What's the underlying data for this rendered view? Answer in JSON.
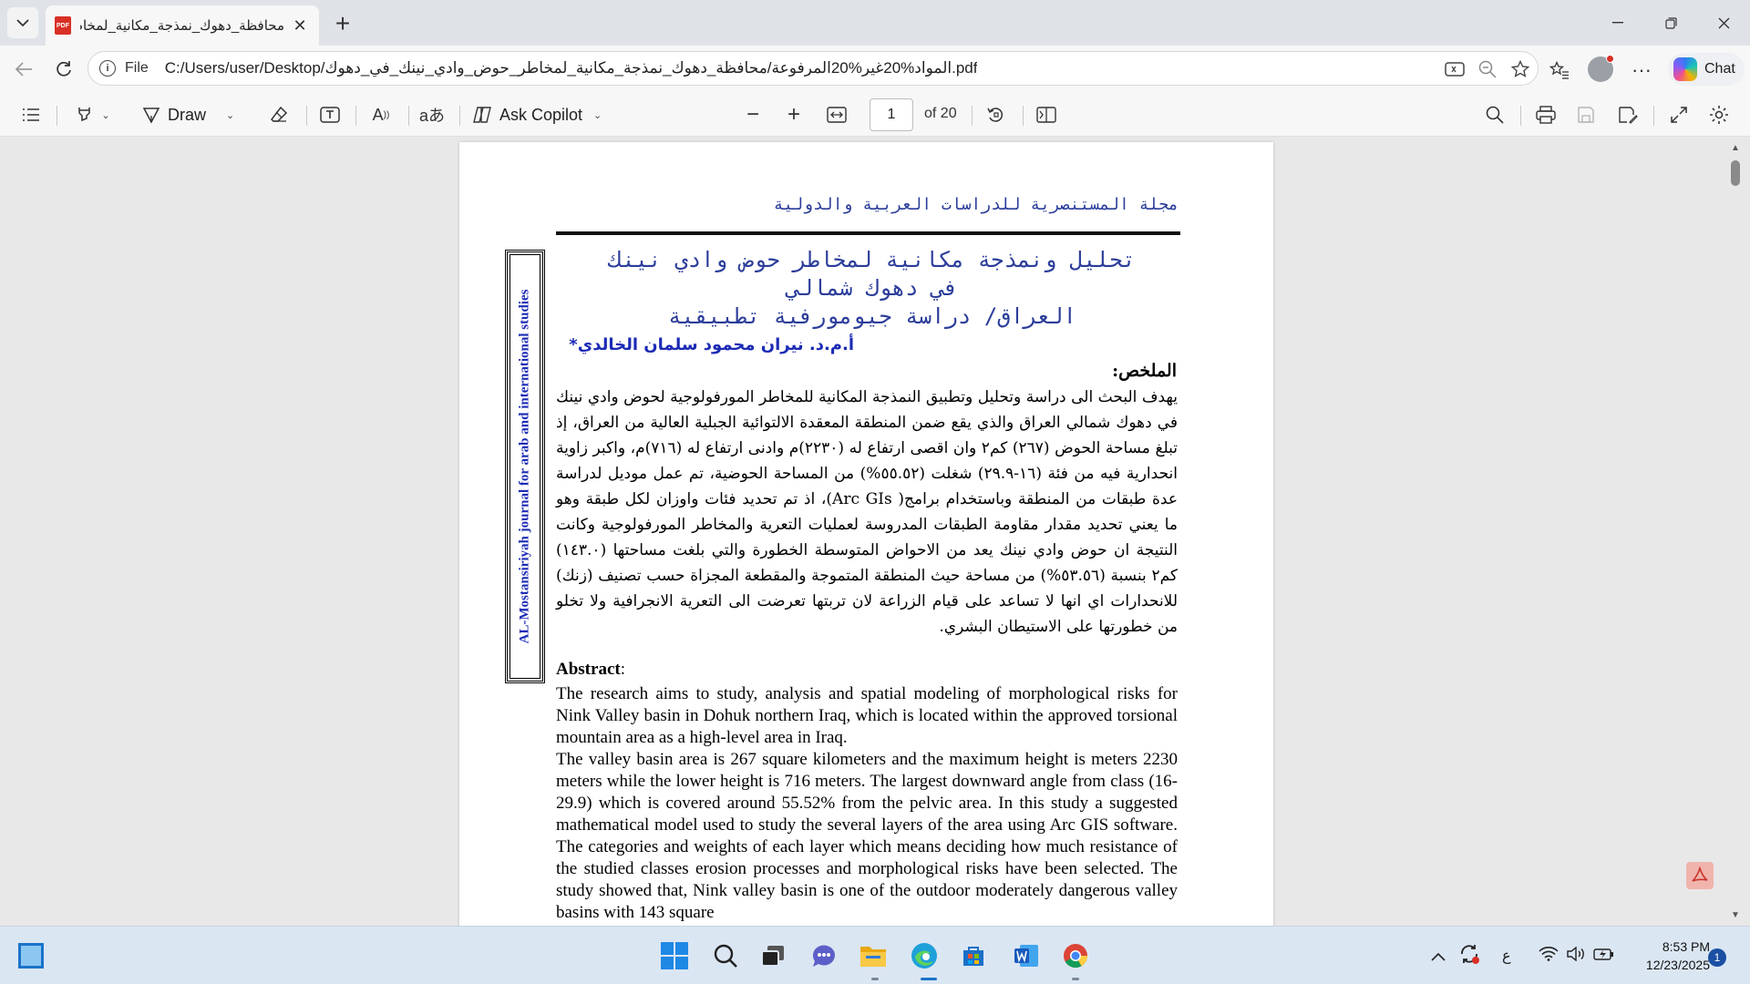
{
  "browser": {
    "tab_title": "محافظة_دهوك_نمذجة_مكانية_لمخاط...",
    "tab_icon": "pdf-icon",
    "address": {
      "scheme_label": "File",
      "url": "C:/Users/user/Desktop/المواد%20غير%20المرفوعة/محافظة_دهوك_نمذجة_مكانية_لمخاطر_حوض_وادي_نينك_في_دهوك.pdf"
    },
    "chat_label": "Chat"
  },
  "pdf_toolbar": {
    "draw_label": "Draw",
    "ask_copilot_label": "Ask Copilot",
    "page_current": "1",
    "page_total": "of 20"
  },
  "document": {
    "journal_header": "مجلة المستنصرية للدراسات العربية والدولية",
    "side_label": "AL-Mostansiriyah journal for arab and international studies",
    "title_lines": [
      "تحليل ونمذجة مكانية لمخاطر حوض وادي نينك",
      "في دهوك شمالي",
      "العراق/ دراسة جيومورفية تطبيقية"
    ],
    "author": "أ.م.د.  نيران محمود سلمان الخالدي*",
    "summary_heading": "الملخص:",
    "summary_text": "يهدف البحث الى دراسة وتحليل وتطبيق النمذجة المكانية للمخاطر المورفولوجية لحوض وادي نينك في دهوك شمالي العراق والذي يقع ضمن المنطقة المعقدة الالتوائية الجبلية العالية من العراق، إذ تبلغ مساحة الحوض (٢٦٧) كم٢ وان اقصى ارتفاع له (٢٢٣٠)م وادنى ارتفاع له (٧١٦)م، واكبر زاوية انحدارية فيه من فئة (١٦-٢٩.٩) شغلت (٥٥.٥٢%) من المساحة الحوضية، تم عمل موديل لدراسة عدة طبقات من المنطقة وباستخدام برامج( Arc GIs)، اذ تم تحديد فئات واوزان لكل طبقة وهو ما يعني تحديد مقدار مقاومة الطبقات المدروسة لعمليات التعرية والمخاطر المورفولوجية وكانت النتيجة ان حوض وادي نينك يعد من الاحواض المتوسطة الخطورة والتي بلغت مساحتها (١٤٣.٠) كم٢ بنسبة (٥٣.٥٦%) من مساحة حيث المنطقة المتموجة والمقطعة المجزاة حسب تصنيف (زنك) للانحدارات اي انها لا تساعد على قيام الزراعة لان تربتها تعرضت الى التعرية الانجرافية ولا تخلو من خطورتها على الاستيطان البشري.",
    "abstract_heading": "Abstract",
    "abstract_colon": ":",
    "abstract_para1": "The research aims to study, analysis and spatial modeling of morphological risks for Nink Valley basin in Dohuk northern Iraq, which is located within the approved torsional mountain area as a high-level area in Iraq.",
    "abstract_para2": "The valley basin area is 267 square kilometers and the maximum height is meters 2230 meters while the lower height is 716 meters. The largest downward angle from class (16-29.9) which is covered around 55.52% from the pelvic area. In this study a suggested mathematical model used to study the several layers of the area using Arc GIS software. The categories and weights of each layer which means deciding how much resistance of the studied classes erosion processes and morphological risks have been selected. The study showed that, Nink valley basin is one of the outdoor moderately dangerous valley basins with 143 square"
  },
  "taskbar": {
    "language_indicator": "ع",
    "time": "8:53 PM",
    "date": "12/23/2025",
    "notification_count": "1"
  },
  "colors": {
    "journal_blue": "#2b3d9a",
    "title_blue": "#1c2bb5",
    "pdf_red": "#d93025",
    "taskbar_bg": "#dbe6f3"
  }
}
